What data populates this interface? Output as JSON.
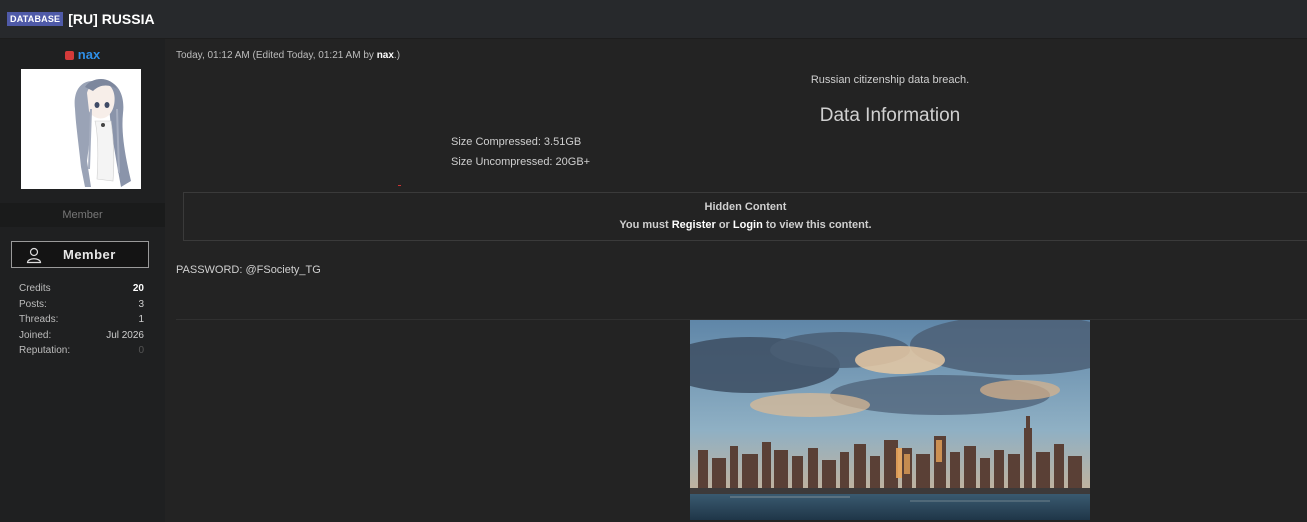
{
  "thread": {
    "prefix": "DATABASE",
    "title": "[RU] RUSSIA"
  },
  "author": {
    "username": "nax",
    "user_title": "Member",
    "rank_label": "Member",
    "stats": [
      {
        "label": "Credits",
        "value": "20"
      },
      {
        "label": "Posts:",
        "value": "3"
      },
      {
        "label": "Threads:",
        "value": "1"
      },
      {
        "label": "Joined:",
        "value": "Jul 2026"
      },
      {
        "label": "Reputation:",
        "value": "0"
      }
    ]
  },
  "post": {
    "meta_prefix": "Today, 01:12 AM (Edited Today, 01:21 AM by ",
    "meta_editor": "nax",
    "meta_suffix": ".)",
    "intro": "Russian citizenship data breach.",
    "heading": "Data Information",
    "size_compressed": "Size Compressed: 3.51GB",
    "size_uncompressed": "Size Uncompressed: 20GB+",
    "hidden": {
      "title": "Hidden Content",
      "msg_prefix": "You must ",
      "register": "Register",
      "or": " or ",
      "login": "Login",
      "msg_suffix": " to view this content."
    },
    "password": "PASSWORD: @FSociety_TG"
  }
}
